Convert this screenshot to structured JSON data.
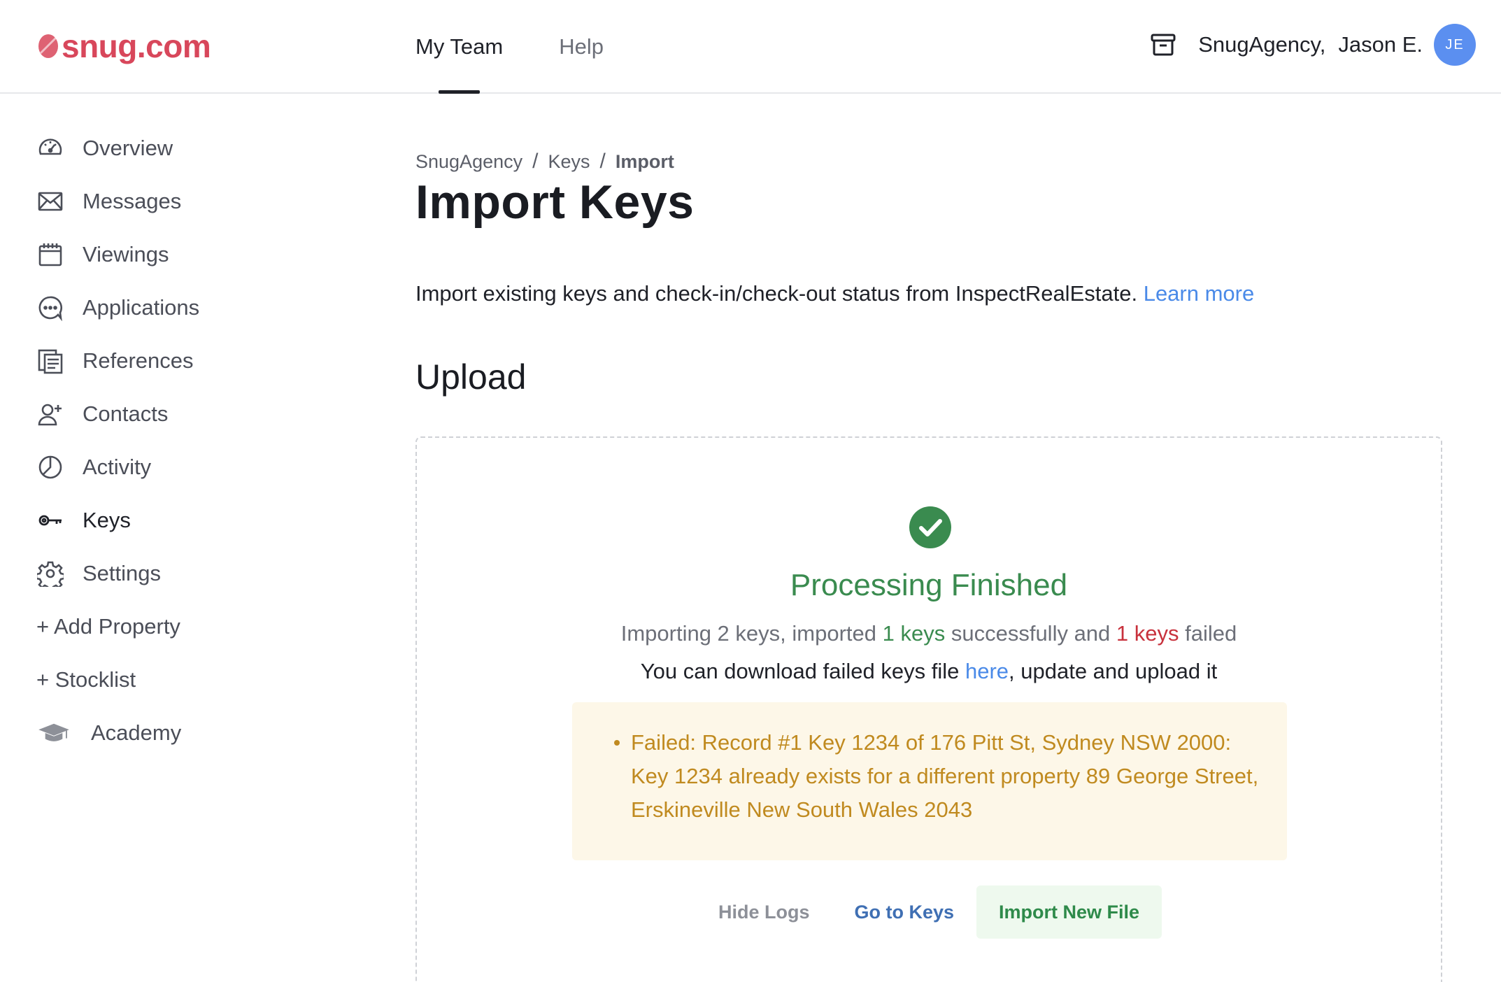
{
  "header": {
    "logo_text": "snug.com",
    "nav": [
      {
        "label": "My Team",
        "active": true
      },
      {
        "label": "Help",
        "active": false
      }
    ],
    "agency_name": "SnugAgency,",
    "user_name": "Jason E.",
    "avatar_initials": "JE"
  },
  "sidebar": {
    "items": [
      {
        "label": "Overview",
        "icon": "gauge-icon"
      },
      {
        "label": "Messages",
        "icon": "envelope-icon"
      },
      {
        "label": "Viewings",
        "icon": "calendar-icon"
      },
      {
        "label": "Applications",
        "icon": "chat-bubble-icon"
      },
      {
        "label": "References",
        "icon": "documents-icon"
      },
      {
        "label": "Contacts",
        "icon": "user-plus-icon"
      },
      {
        "label": "Activity",
        "icon": "pie-chart-icon"
      },
      {
        "label": "Keys",
        "icon": "key-icon"
      },
      {
        "label": "Settings",
        "icon": "gear-icon"
      },
      {
        "label": "+ Add Property"
      },
      {
        "label": "+ Stocklist"
      },
      {
        "label": "Academy",
        "icon": "graduation-cap-icon"
      }
    ]
  },
  "breadcrumb": [
    "SnugAgency",
    "Keys",
    "Import"
  ],
  "page_title": "Import Keys",
  "intro": {
    "text": "Import existing keys and check-in/check-out status from InspectRealEstate.",
    "link": "Learn more"
  },
  "section_title": "Upload",
  "result": {
    "title": "Processing Finished",
    "summary_prefix": "Importing 2 keys, imported",
    "summary_ok": "1 keys",
    "summary_middle": "successfully and",
    "summary_bad": "1 keys",
    "summary_suffix": "failed",
    "download_prefix": "You can download failed keys file",
    "download_link": "here",
    "download_suffix": ", update and upload it",
    "logs": [
      "Failed: Record #1 Key 1234 of 176 Pitt St, Sydney NSW 2000: Key 1234 already exists for a different property 89 George Street, Erskineville New South Wales 2043"
    ]
  },
  "actions": {
    "hide_logs": "Hide Logs",
    "go_to_keys": "Go to Keys",
    "import_new": "Import New File"
  },
  "colors": {
    "brand": "#d8475b",
    "link": "#4a8ae8",
    "success": "#3a8b4f",
    "error": "#c8323d",
    "warning_text": "#c08a1f",
    "warning_bg": "#fdf7e8"
  }
}
